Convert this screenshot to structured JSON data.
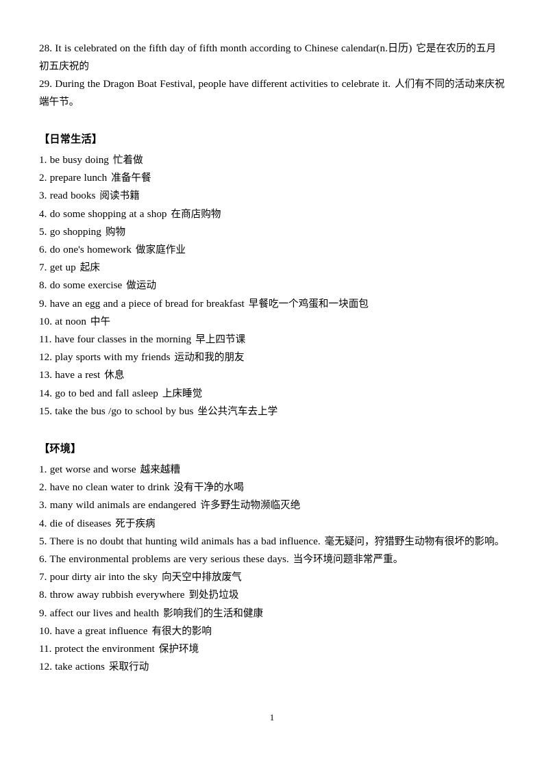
{
  "document": {
    "page_number": "1",
    "intro_paragraphs": [
      {
        "id": "item-28",
        "english": "28. It is celebrated on the fifth day of fifth month according to Chinese calendar(n.日历)",
        "chinese": "它是在农历的五月初五庆祝的"
      },
      {
        "id": "item-29",
        "english": "29. During the Dragon Boat Festival, people have different activities to celebrate it.",
        "chinese": "人们有不同的活动来庆祝端午节。"
      }
    ],
    "sections": [
      {
        "id": "daily-life",
        "heading": "【日常生活】",
        "items": [
          {
            "english": "1. be busy doing",
            "chinese": "忙着做"
          },
          {
            "english": "2. prepare lunch",
            "chinese": "准备午餐"
          },
          {
            "english": "3. read books",
            "chinese": "阅读书籍"
          },
          {
            "english": "4. do some shopping at a shop",
            "chinese": "在商店购物"
          },
          {
            "english": "5. go shopping",
            "chinese": "购物"
          },
          {
            "english": "6. do one's homework",
            "chinese": "做家庭作业"
          },
          {
            "english": "7. get up",
            "chinese": "起床"
          },
          {
            "english": "8. do some exercise",
            "chinese": "做运动"
          },
          {
            "english": "9. have an egg and a piece of bread for breakfast",
            "chinese": "早餐吃一个鸡蛋和一块面包"
          },
          {
            "english": "10. at noon",
            "chinese": "中午"
          },
          {
            "english": "11. have four classes in the morning",
            "chinese": "早上四节课"
          },
          {
            "english": "12. play sports with my friends",
            "chinese": "运动和我的朋友"
          },
          {
            "english": "13. have a rest",
            "chinese": "休息"
          },
          {
            "english": "14. go to bed and fall asleep",
            "chinese": "上床睡觉"
          },
          {
            "english": "15. take the bus /go to school by bus",
            "chinese": "坐公共汽车去上学"
          }
        ]
      },
      {
        "id": "environment",
        "heading": "【环境】",
        "items": [
          {
            "english": "1. get worse and worse",
            "chinese": "越来越糟"
          },
          {
            "english": "2. have no clean water to drink",
            "chinese": "没有干净的水喝"
          },
          {
            "english": "3. many wild animals are endangered",
            "chinese": "许多野生动物濒临灭绝"
          },
          {
            "english": "4. die of diseases",
            "chinese": "死于疾病"
          },
          {
            "english": "5. There is no doubt that hunting wild animals has a bad influence.",
            "chinese": "毫无疑问，狩猎野生动物有很坏的影响。"
          },
          {
            "english": "6. The environmental problems are very serious these days.",
            "chinese": "当今环境问题非常严重。"
          },
          {
            "english": "7. pour dirty air into the sky",
            "chinese": "向天空中排放废气"
          },
          {
            "english": "8. throw away rubbish everywhere",
            "chinese": "到处扔垃圾"
          },
          {
            "english": "9. affect our lives and health",
            "chinese": "影响我们的生活和健康"
          },
          {
            "english": "10. have a great influence",
            "chinese": "有很大的影响"
          },
          {
            "english": "11. protect the environment",
            "chinese": "保护环境"
          },
          {
            "english": "12. take actions",
            "chinese": "采取行动"
          }
        ]
      }
    ]
  }
}
